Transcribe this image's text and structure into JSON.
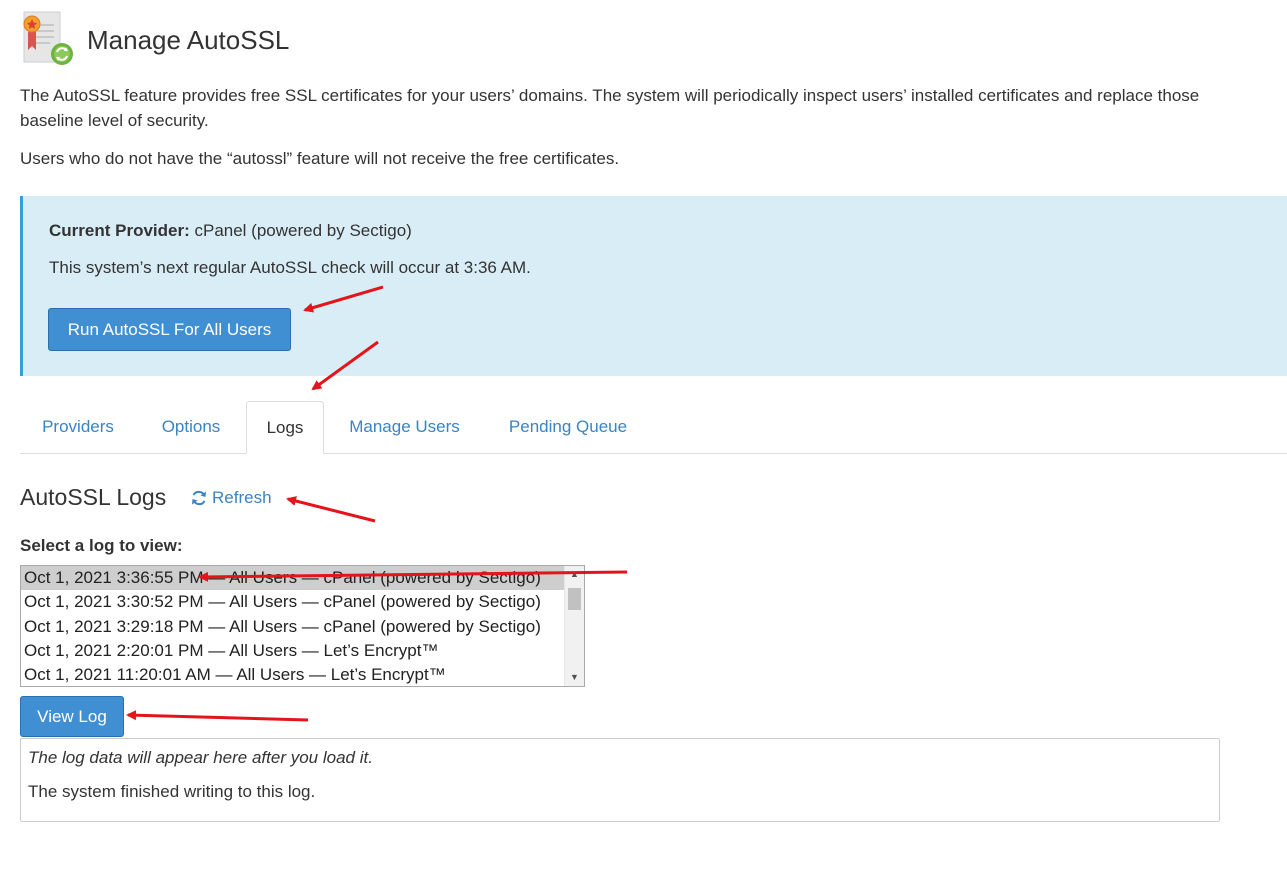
{
  "header": {
    "title": "Manage AutoSSL",
    "icon": "certificate-icon"
  },
  "intro": {
    "line1": "The AutoSSL feature provides free SSL certificates for your users’ domains. The system will periodically inspect users’ installed certificates and replace those",
    "line2": "baseline level of security.",
    "note": "Users who do not have the “autossl” feature will not receive the free certificates."
  },
  "provider_box": {
    "provider_label": "Current Provider:",
    "provider_value": "cPanel (powered by Sectigo)",
    "next_check": "This system’s next regular AutoSSL check will occur at 3:36 AM.",
    "run_button": "Run AutoSSL For All Users"
  },
  "tabs": [
    {
      "label": "Providers",
      "active": false
    },
    {
      "label": "Options",
      "active": false
    },
    {
      "label": "Logs",
      "active": true
    },
    {
      "label": "Manage Users",
      "active": false
    },
    {
      "label": "Pending Queue",
      "active": false
    }
  ],
  "logs": {
    "heading": "AutoSSL Logs",
    "refresh_label": "Refresh",
    "select_label": "Select a log to view:",
    "items": [
      "Oct 1, 2021 3:36:55 PM — All Users — cPanel (powered by Sectigo)",
      "Oct 1, 2021 3:30:52 PM — All Users — cPanel (powered by Sectigo)",
      "Oct 1, 2021 3:29:18 PM — All Users — cPanel (powered by Sectigo)",
      "Oct 1, 2021 2:20:01 PM — All Users — Let’s Encrypt™",
      "Oct 1, 2021 11:20:01 AM — All Users — Let’s Encrypt™"
    ],
    "selected_index": 0,
    "view_button": "View Log",
    "output_placeholder": "The log data will appear here after you load it.",
    "output_status": "The system finished writing to this log."
  },
  "colors": {
    "accent": "#3f8fd2",
    "link": "#3a83c4",
    "info_bg": "#d9edf7",
    "info_border": "#31a1d8",
    "annotation_arrow": "#e3151a"
  }
}
